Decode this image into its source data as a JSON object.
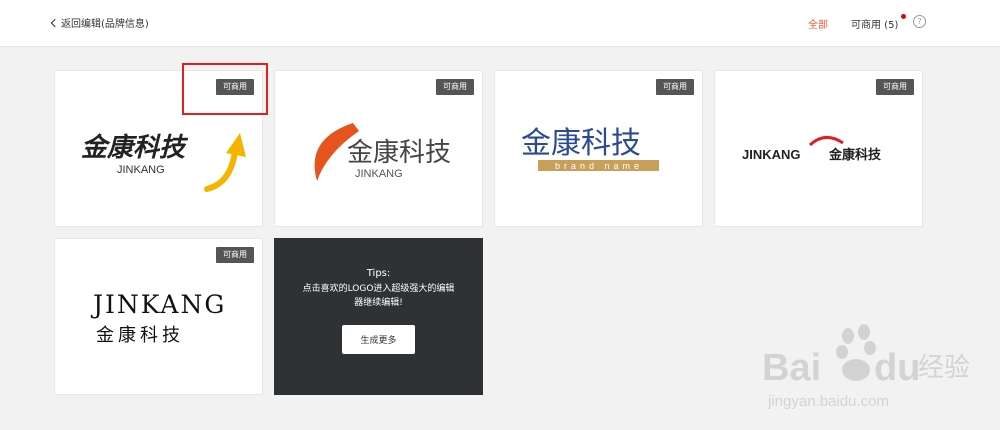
{
  "header": {
    "back_label": "返回编辑(品牌信息)",
    "filter_all": "全部",
    "filter_commercial": "可商用 (5)",
    "help_symbol": "?"
  },
  "colors": {
    "accent": "#f05a2a",
    "badge_bg": "#555555",
    "notify_dot": "#e60012",
    "tips_bg": "#2f3235",
    "highlight": "#e02020"
  },
  "logos": [
    {
      "badge": "可商用",
      "brand_cn": "金康科技",
      "brand_en": "JINKANG"
    },
    {
      "badge": "可商用",
      "brand_cn": "金康科技",
      "brand_en": "JINKANG"
    },
    {
      "badge": "可商用",
      "brand_cn": "金康科技",
      "tagline": "brand name"
    },
    {
      "badge": "可商用",
      "brand_en": "JINKANG",
      "brand_cn": "金康科技"
    },
    {
      "badge": "可商用",
      "brand_en": "JINKANG",
      "brand_cn": "金康科技"
    }
  ],
  "tips": {
    "title": "Tips:",
    "line1": "点击喜欢的LOGO进入超级强大的编辑",
    "line2": "器继续编辑!",
    "button": "生成更多"
  },
  "watermark": {
    "brand": "Bai",
    "brand2": "du",
    "cn": "经验",
    "url": "jingyan.baidu.com"
  }
}
